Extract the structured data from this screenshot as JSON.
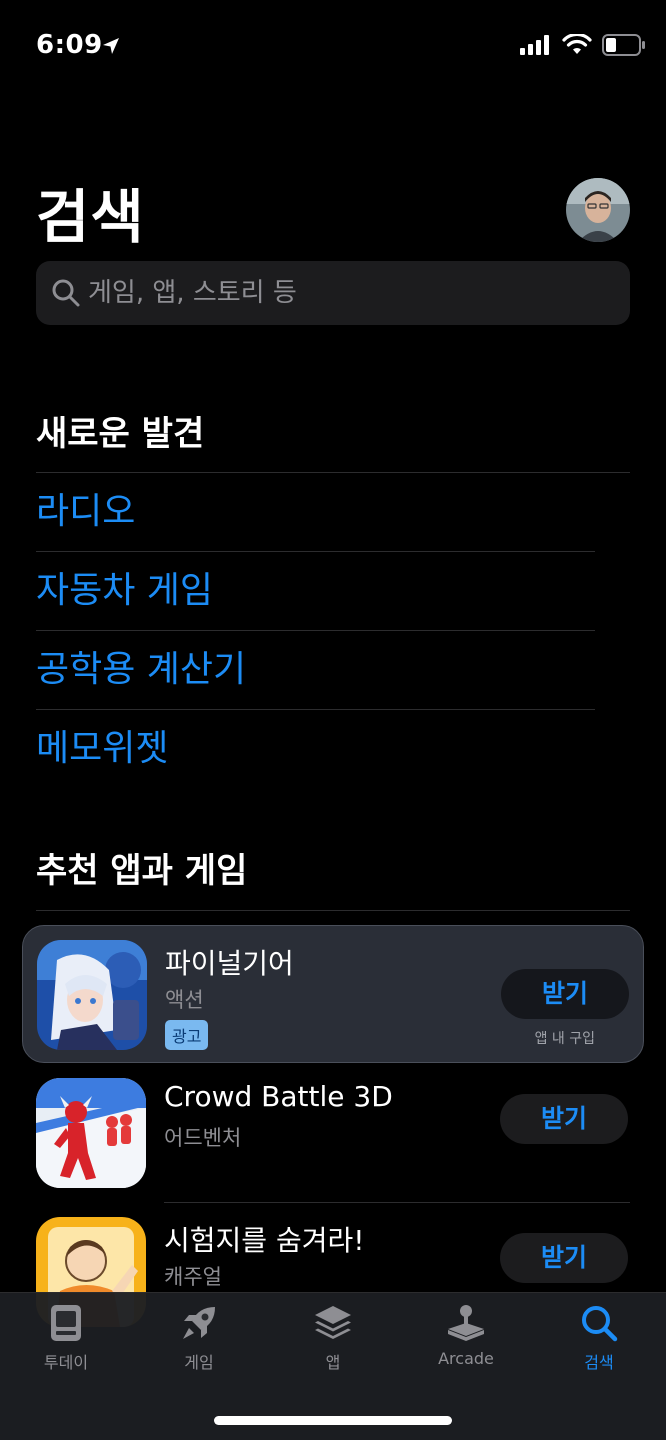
{
  "status_bar": {
    "time": "6:09"
  },
  "header": {
    "title": "검색"
  },
  "search": {
    "placeholder": "게임, 앱, 스토리 등"
  },
  "discover": {
    "title": "새로운 발견",
    "items": [
      "라디오",
      "자동차 게임",
      "공학용 계산기",
      "메모위젯"
    ]
  },
  "suggested": {
    "title": "추천 앱과 게임",
    "apps": [
      {
        "name": "파이널기어",
        "category": "액션",
        "badge": "광고",
        "button": "받기",
        "note": "앱 내 구입"
      },
      {
        "name": "Crowd Battle 3D",
        "category": "어드벤처",
        "button": "받기"
      },
      {
        "name": "시험지를 숨겨라!",
        "category": "캐주얼",
        "button": "받기"
      }
    ]
  },
  "tabs": [
    {
      "label": "투데이",
      "icon": "today-icon"
    },
    {
      "label": "게임",
      "icon": "rocket-icon"
    },
    {
      "label": "앱",
      "icon": "layers-icon"
    },
    {
      "label": "Arcade",
      "icon": "joystick-icon"
    },
    {
      "label": "검색",
      "icon": "search-icon"
    }
  ],
  "colors": {
    "accent": "#1c8cf5",
    "background": "#000000",
    "card": "#2a2e37"
  }
}
